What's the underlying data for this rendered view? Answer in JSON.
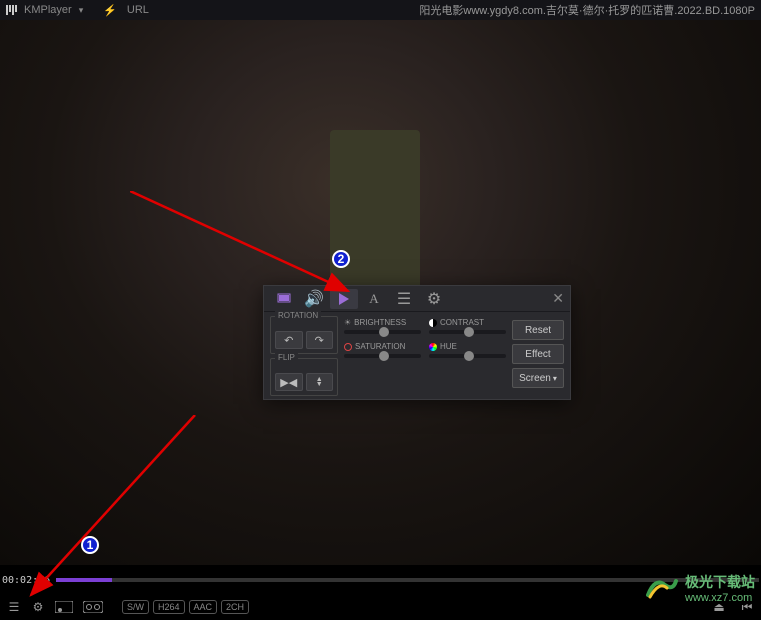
{
  "titlebar": {
    "app_name": "KMPlayer",
    "url_label": "URL",
    "file_title": "阳光电影www.ygdy8.com.吉尔莫·德尔·托罗的匹诺曹.2022.BD.1080P"
  },
  "timeline": {
    "current_time": "00:02:56"
  },
  "bottombar": {
    "tags": [
      "S/W",
      "H264",
      "AAC",
      "2CH"
    ]
  },
  "panel": {
    "tabs": [
      "display",
      "audio",
      "play",
      "text",
      "list",
      "settings"
    ],
    "rotation_label": "ROTATION",
    "flip_label": "FLIP",
    "brightness_label": "BRIGHTNESS",
    "contrast_label": "CONTRAST",
    "saturation_label": "SATURATION",
    "hue_label": "HUE",
    "reset_label": "Reset",
    "effect_label": "Effect",
    "screen_label": "Screen"
  },
  "annotations": {
    "badge1": "1",
    "badge2": "2"
  },
  "watermark": {
    "text": "极光下载站",
    "sub": "www.xz7.com"
  }
}
